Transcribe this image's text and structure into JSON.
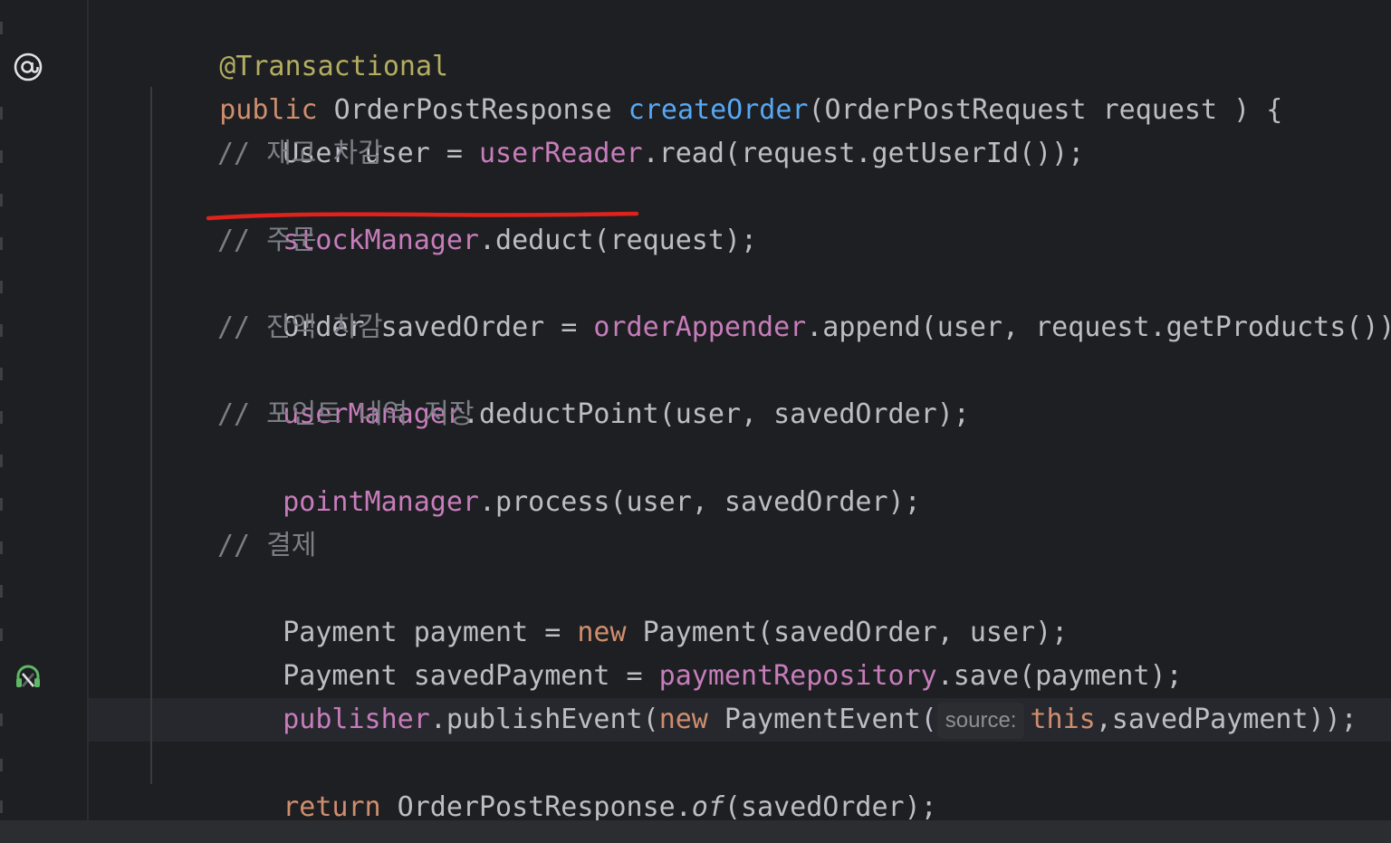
{
  "editor": {
    "language": "Java",
    "theme_colors": {
      "background": "#1e1f22",
      "keyword": "#cf8e6d",
      "annotation": "#b3ae60",
      "field": "#c77dbb",
      "method_declaration": "#56a8f5",
      "comment": "#7a7e85",
      "default_text": "#bcbec4",
      "underline_markup": "#e0221c"
    },
    "gutter_icons": [
      "at-sign-icon",
      "event-publisher-headset-icon"
    ],
    "code": {
      "annotation": "@Transactional",
      "method_signature": {
        "modifier": "public",
        "return_type": " OrderPostResponse ",
        "name": "createOrder",
        "params": "(OrderPostRequest request ) {"
      },
      "l1": {
        "a": "User user = ",
        "field": "userReader",
        "b": ".read(request.getUserId());"
      },
      "c1": "// 재고 차감",
      "l2": {
        "field": "stockManager",
        "b": ".deduct(request);"
      },
      "c2": "// 주문",
      "l3": {
        "a": "Order savedOrder = ",
        "field": "orderAppender",
        "b": ".append(user, request.getProducts());"
      },
      "c3": "// 잔액 차감",
      "l4": {
        "field": "userManager",
        "b": ".deductPoint(user, savedOrder);"
      },
      "c4": "// 포인트 내역 저장",
      "l5": {
        "field": "pointManager",
        "b": ".process(user, savedOrder);"
      },
      "c5": "// 결제",
      "l6": {
        "a": "Payment payment = ",
        "kw": "new",
        "b": " Payment(savedOrder, user);"
      },
      "l7": {
        "a": "Payment savedPayment = ",
        "field": "paymentRepository",
        "b": ".save(payment);"
      },
      "l8": {
        "field": "publisher",
        "a": ".publishEvent(",
        "kw": "new",
        "b": " PaymentEvent(",
        "hint": "source:",
        "this": "this",
        "c": ",savedPayment));"
      },
      "l9": {
        "kw": "return",
        "a": " OrderPostResponse.",
        "static_method": "of",
        "b": "(savedOrder);"
      },
      "closing_brace": "}"
    }
  }
}
